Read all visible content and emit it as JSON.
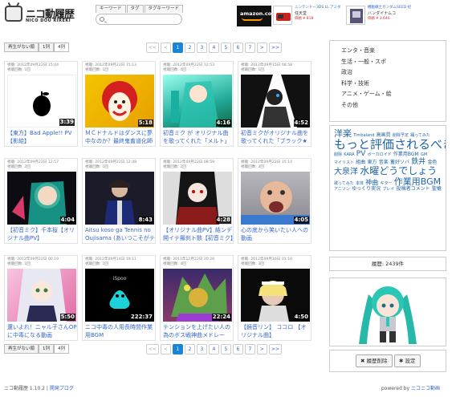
{
  "header": {
    "logo_title": "ニコ動履歴",
    "logo_sub": "NICO DOU RIREKI",
    "search_tabs": [
      "キーワード",
      "タグ",
      "タグキーワード"
    ],
    "search_placeholder": "",
    "ads": [
      {
        "brand": "amazon.co.jp"
      },
      {
        "line1": "ニンテンドー3DS LL アミダ",
        "line2": "任天堂",
        "line3": "価格 ¥ 818"
      },
      {
        "line1": "機動戦士ガンダムSEED 初",
        "line2": "バンダイナムコ",
        "line3": "価格 ¥ 3,640"
      }
    ]
  },
  "toolbar": {
    "view_buttons": [
      "再生がない順",
      "1列",
      "4列"
    ],
    "pager": [
      "<<",
      "<",
      "1",
      "2",
      "3",
      "4",
      "5",
      "6",
      "7",
      ">",
      ">>"
    ],
    "current_page": "1"
  },
  "videos": [
    {
      "meta1": "視聴: 2012年09月22日 15:04",
      "meta2": "視聴回数: 1回",
      "duration": "3:39",
      "title": "【東方】Bad Apple!! PV【影絵】"
    },
    {
      "meta1": "視聴: 2012年09月22日 15:13",
      "meta2": "視聴回数: 1回",
      "duration": "5:18",
      "title": "ＭＣドナルドはダンスに夢中なのか？最終鬼畜道化師ドナルド・Ｍ"
    },
    {
      "meta1": "視聴: 2012年09月22日 12:53",
      "meta2": "視聴回数: 4回",
      "duration": "4:16",
      "title": "初音ミク が オリジナル曲を歌ってくれた「メルト」"
    },
    {
      "meta1": "視聴: 2012年09月15日 08:58",
      "meta2": "視聴回数: 1回",
      "duration": "4:52",
      "title": "初音ミクがオリジナル曲を歌ってくれた「ブラック★ロックシューター」"
    },
    {
      "meta1": "視聴: 2012年09月22日 12:57",
      "meta2": "視聴回数: 2回",
      "duration": "4:04",
      "title": "【初音ミク】千本桜【オリジナル曲PV】"
    },
    {
      "meta1": "視聴: 2012年09月22日 12:48",
      "meta2": "視聴回数: 1回",
      "duration": "8:43",
      "title": "Aitsu koso ga Tennis no Oujisama (あいつこそがテニスの王子様)"
    },
    {
      "meta1": "視聴: 2012年09月22日 08:59",
      "meta2": "視聴回数: 2回",
      "duration": "4:28",
      "title": "【オリジナル曲PV】結ンデ開イテ羅刹ト骸【初音ミク】"
    },
    {
      "meta1": "視聴: 2012年09月22日 15:14",
      "meta2": "視聴回数: 3回",
      "duration": "4:05",
      "title": "心の底から笑いたい人への動画"
    },
    {
      "meta1": "視聴: 2012年09月22日 00:19",
      "meta2": "視聴回数: 1回",
      "duration": "5:50",
      "title": "還いよれ！ニャル子さんOPに中毒になる動画"
    },
    {
      "meta1": "視聴: 2012年09月14日 19:11",
      "meta2": "視聴回数: 1回",
      "duration": "222:37",
      "title": "ニコ中毒の人用長時間作業用BGM"
    },
    {
      "meta1": "視聴: 2011年12月22日 20:28",
      "meta2": "視聴回数: 4回",
      "duration": "22:24",
      "title": "テンションを上げたい人の為のボス戦神曲メドレー"
    },
    {
      "meta1": "視聴: 2012年09月16日 01:10",
      "meta2": "視聴回数: 3回",
      "duration": "4:50",
      "title": "【鏡音リン】 ココロ 【オリジナル曲】"
    }
  ],
  "sidebar": {
    "categories": [
      "エンタ・音楽",
      "生活・一般・スポ",
      "政治",
      "科学・技術",
      "アニメ・ゲーム・絵",
      "その他"
    ],
    "tags": [
      {
        "t": "洋楽",
        "s": 11
      },
      {
        "t": "Timbaland",
        "s": 5
      },
      {
        "t": "高画質",
        "s": 6
      },
      {
        "t": "削除予定",
        "s": 5
      },
      {
        "t": "踊ってみた",
        "s": 5
      },
      {
        "t": "もっと評価されるべき",
        "s": 15
      },
      {
        "t": "削除",
        "s": 5
      },
      {
        "t": "KARA",
        "s": 5
      },
      {
        "t": "PV",
        "s": 9
      },
      {
        "t": "ボーカロイド",
        "s": 5
      },
      {
        "t": "作業用BGM",
        "s": 6
      },
      {
        "t": "GM",
        "s": 5
      },
      {
        "t": "マイリスト",
        "s": 5
      },
      {
        "t": "組曲",
        "s": 6
      },
      {
        "t": "東方",
        "s": 6
      },
      {
        "t": "音楽",
        "s": 6
      },
      {
        "t": "蓄好ソバ",
        "s": 6
      },
      {
        "t": "鉄井",
        "s": 9
      },
      {
        "t": "金色",
        "s": 6
      },
      {
        "t": "大泉洋",
        "s": 10
      },
      {
        "t": "水曜どうでしょう",
        "s": 12
      },
      {
        "t": "歌ってみた",
        "s": 5
      },
      {
        "t": "本体",
        "s": 5
      },
      {
        "t": "神曲",
        "s": 8
      },
      {
        "t": "ギター",
        "s": 5
      },
      {
        "t": "作業用BGM",
        "s": 11
      },
      {
        "t": "アニソン",
        "s": 5
      },
      {
        "t": "ゆっくり実況",
        "s": 6
      },
      {
        "t": "プレイ",
        "s": 5
      },
      {
        "t": "投稿者コメント",
        "s": 6
      },
      {
        "t": "聖槍",
        "s": 6
      }
    ],
    "history_count": "履歴: 2439件",
    "delete_label": "履歴削除",
    "settings_label": "設定"
  },
  "footer": {
    "left_text": "ニコ動履歴 1.10.2 |",
    "left_link": "開発ブログ",
    "right_text": "powered by",
    "right_brand": "ニコニコ動画"
  },
  "colors": {
    "link": "#3366cc",
    "accent": "#1a84d6",
    "tag": "#1f63a8"
  }
}
